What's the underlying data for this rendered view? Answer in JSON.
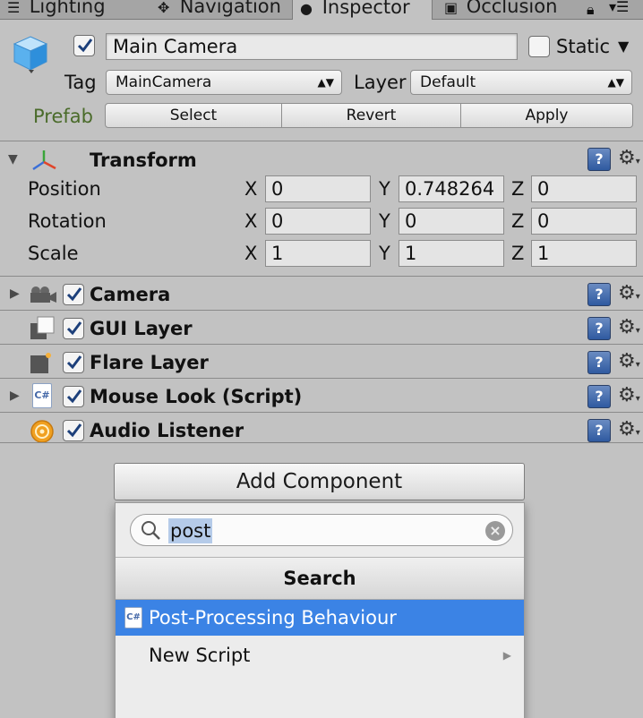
{
  "tabs": [
    {
      "label": "Lighting",
      "icon": "light-icon"
    },
    {
      "label": "Navigation",
      "icon": "navigation-icon"
    },
    {
      "label": "Inspector",
      "icon": "info-icon"
    },
    {
      "label": "Occlusion",
      "icon": "occlusion-icon"
    }
  ],
  "header": {
    "object_name": "Main Camera",
    "static_label": "Static",
    "tag_label": "Tag",
    "tag_value": "MainCamera",
    "layer_label": "Layer",
    "layer_value": "Default",
    "prefab_label": "Prefab",
    "prefab_buttons": [
      "Select",
      "Revert",
      "Apply"
    ]
  },
  "transform": {
    "title": "Transform",
    "rows": [
      {
        "label": "Position",
        "x": "0",
        "y": "0.748264",
        "z": "0"
      },
      {
        "label": "Rotation",
        "x": "0",
        "y": "0",
        "z": "0"
      },
      {
        "label": "Scale",
        "x": "1",
        "y": "1",
        "z": "1"
      }
    ],
    "axis_labels": [
      "X",
      "Y",
      "Z"
    ]
  },
  "components": [
    {
      "name": "Camera",
      "icon": "camera-icon"
    },
    {
      "name": "GUI Layer",
      "icon": "gui-layer-icon"
    },
    {
      "name": "Flare Layer",
      "icon": "flare-layer-icon"
    },
    {
      "name": "Mouse Look (Script)",
      "icon": "csharp-script-icon"
    },
    {
      "name": "Audio Listener",
      "icon": "audio-listener-icon"
    }
  ],
  "add_component": {
    "button_label": "Add Component",
    "search_value": "post",
    "section_header": "Search",
    "items": [
      {
        "label": "Post-Processing Behaviour",
        "selected": true
      },
      {
        "label": "New Script",
        "selected": false
      }
    ]
  },
  "colors": {
    "panel_bg": "#c2c2c2",
    "selection_blue": "#3b83e5",
    "prefab_label": "#4a6b2a"
  }
}
